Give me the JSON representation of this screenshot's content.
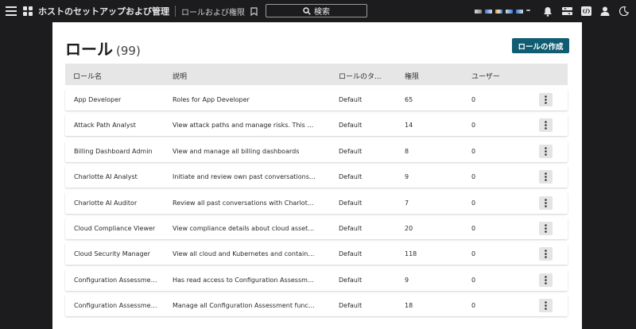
{
  "header": {
    "title": "ホストのセットアップおよび管理",
    "breadcrumb": "ロールおよび権限",
    "search_label": "検索"
  },
  "page": {
    "title": "ロール",
    "count": "(99)",
    "create_button": "ロールの作成"
  },
  "table": {
    "columns": [
      "ロール名",
      "説明",
      "ロールのタ...",
      "権限",
      "ユーザー"
    ],
    "rows": [
      {
        "name": "App Developer",
        "description": "Roles for App Developer",
        "type": "Default",
        "permissions": "65",
        "users": "0"
      },
      {
        "name": "Attack Path Analyst",
        "description": "View attack paths and manage risks. This role do...",
        "type": "Default",
        "permissions": "14",
        "users": "0"
      },
      {
        "name": "Billing Dashboard Admin",
        "description": "View and manage all billing dashboards",
        "type": "Default",
        "permissions": "8",
        "users": "0"
      },
      {
        "name": "Charlotte AI Analyst",
        "description": "Initiate and review own past conversations with C...",
        "type": "Default",
        "permissions": "9",
        "users": "0"
      },
      {
        "name": "Charlotte AI Auditor",
        "description": "Review all past conversations with Charlotte AI fo...",
        "type": "Default",
        "permissions": "7",
        "users": "0"
      },
      {
        "name": "Cloud Compliance Viewer",
        "description": "View compliance details about cloud assets in Fal...",
        "type": "Default",
        "permissions": "20",
        "users": "0"
      },
      {
        "name": "Cloud Security Manager",
        "description": "View all cloud and Kubernetes and containers ass...",
        "type": "Default",
        "permissions": "118",
        "users": "0"
      },
      {
        "name": "Configuration Assessmen...",
        "description": "Has read access to Configuration Assessment fun...",
        "type": "Default",
        "permissions": "9",
        "users": "0"
      },
      {
        "name": "Configuration Assessmen...",
        "description": "Manage all Configuration Assessment functionalit...",
        "type": "Default",
        "permissions": "18",
        "users": "0"
      }
    ]
  },
  "colors": {
    "topbar_bg": "#1c1c1e",
    "primary_button": "#0f5c73",
    "header_row_bg": "#e6e6e6"
  }
}
